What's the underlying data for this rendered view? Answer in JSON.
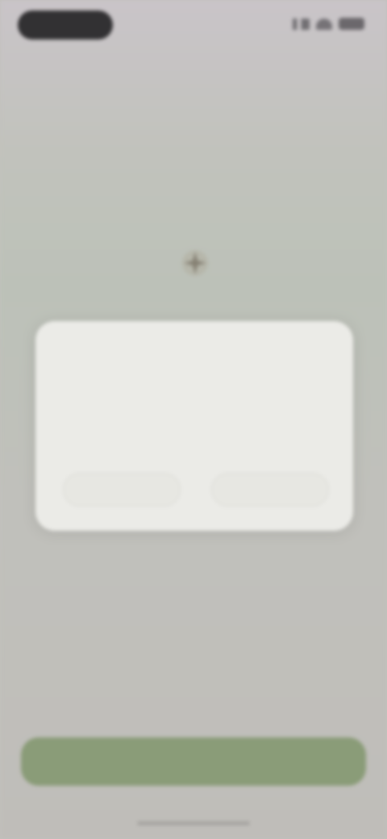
{
  "status_bar": {
    "icons": [
      "signal-icon",
      "wifi-icon",
      "battery-icon"
    ]
  },
  "header": {
    "heading": "",
    "description": ""
  },
  "section": {
    "label": ""
  },
  "center_icon": {
    "name": "sparkle-icon"
  },
  "dialog": {
    "title": "",
    "body": "",
    "secondary_label": "",
    "primary_label": ""
  },
  "primary_action": {
    "label": ""
  },
  "colors": {
    "background": "#c2c1bc",
    "dialog_background": "#ebebe7",
    "primary_green": "#8a9c78",
    "status_pill": "#323133"
  }
}
